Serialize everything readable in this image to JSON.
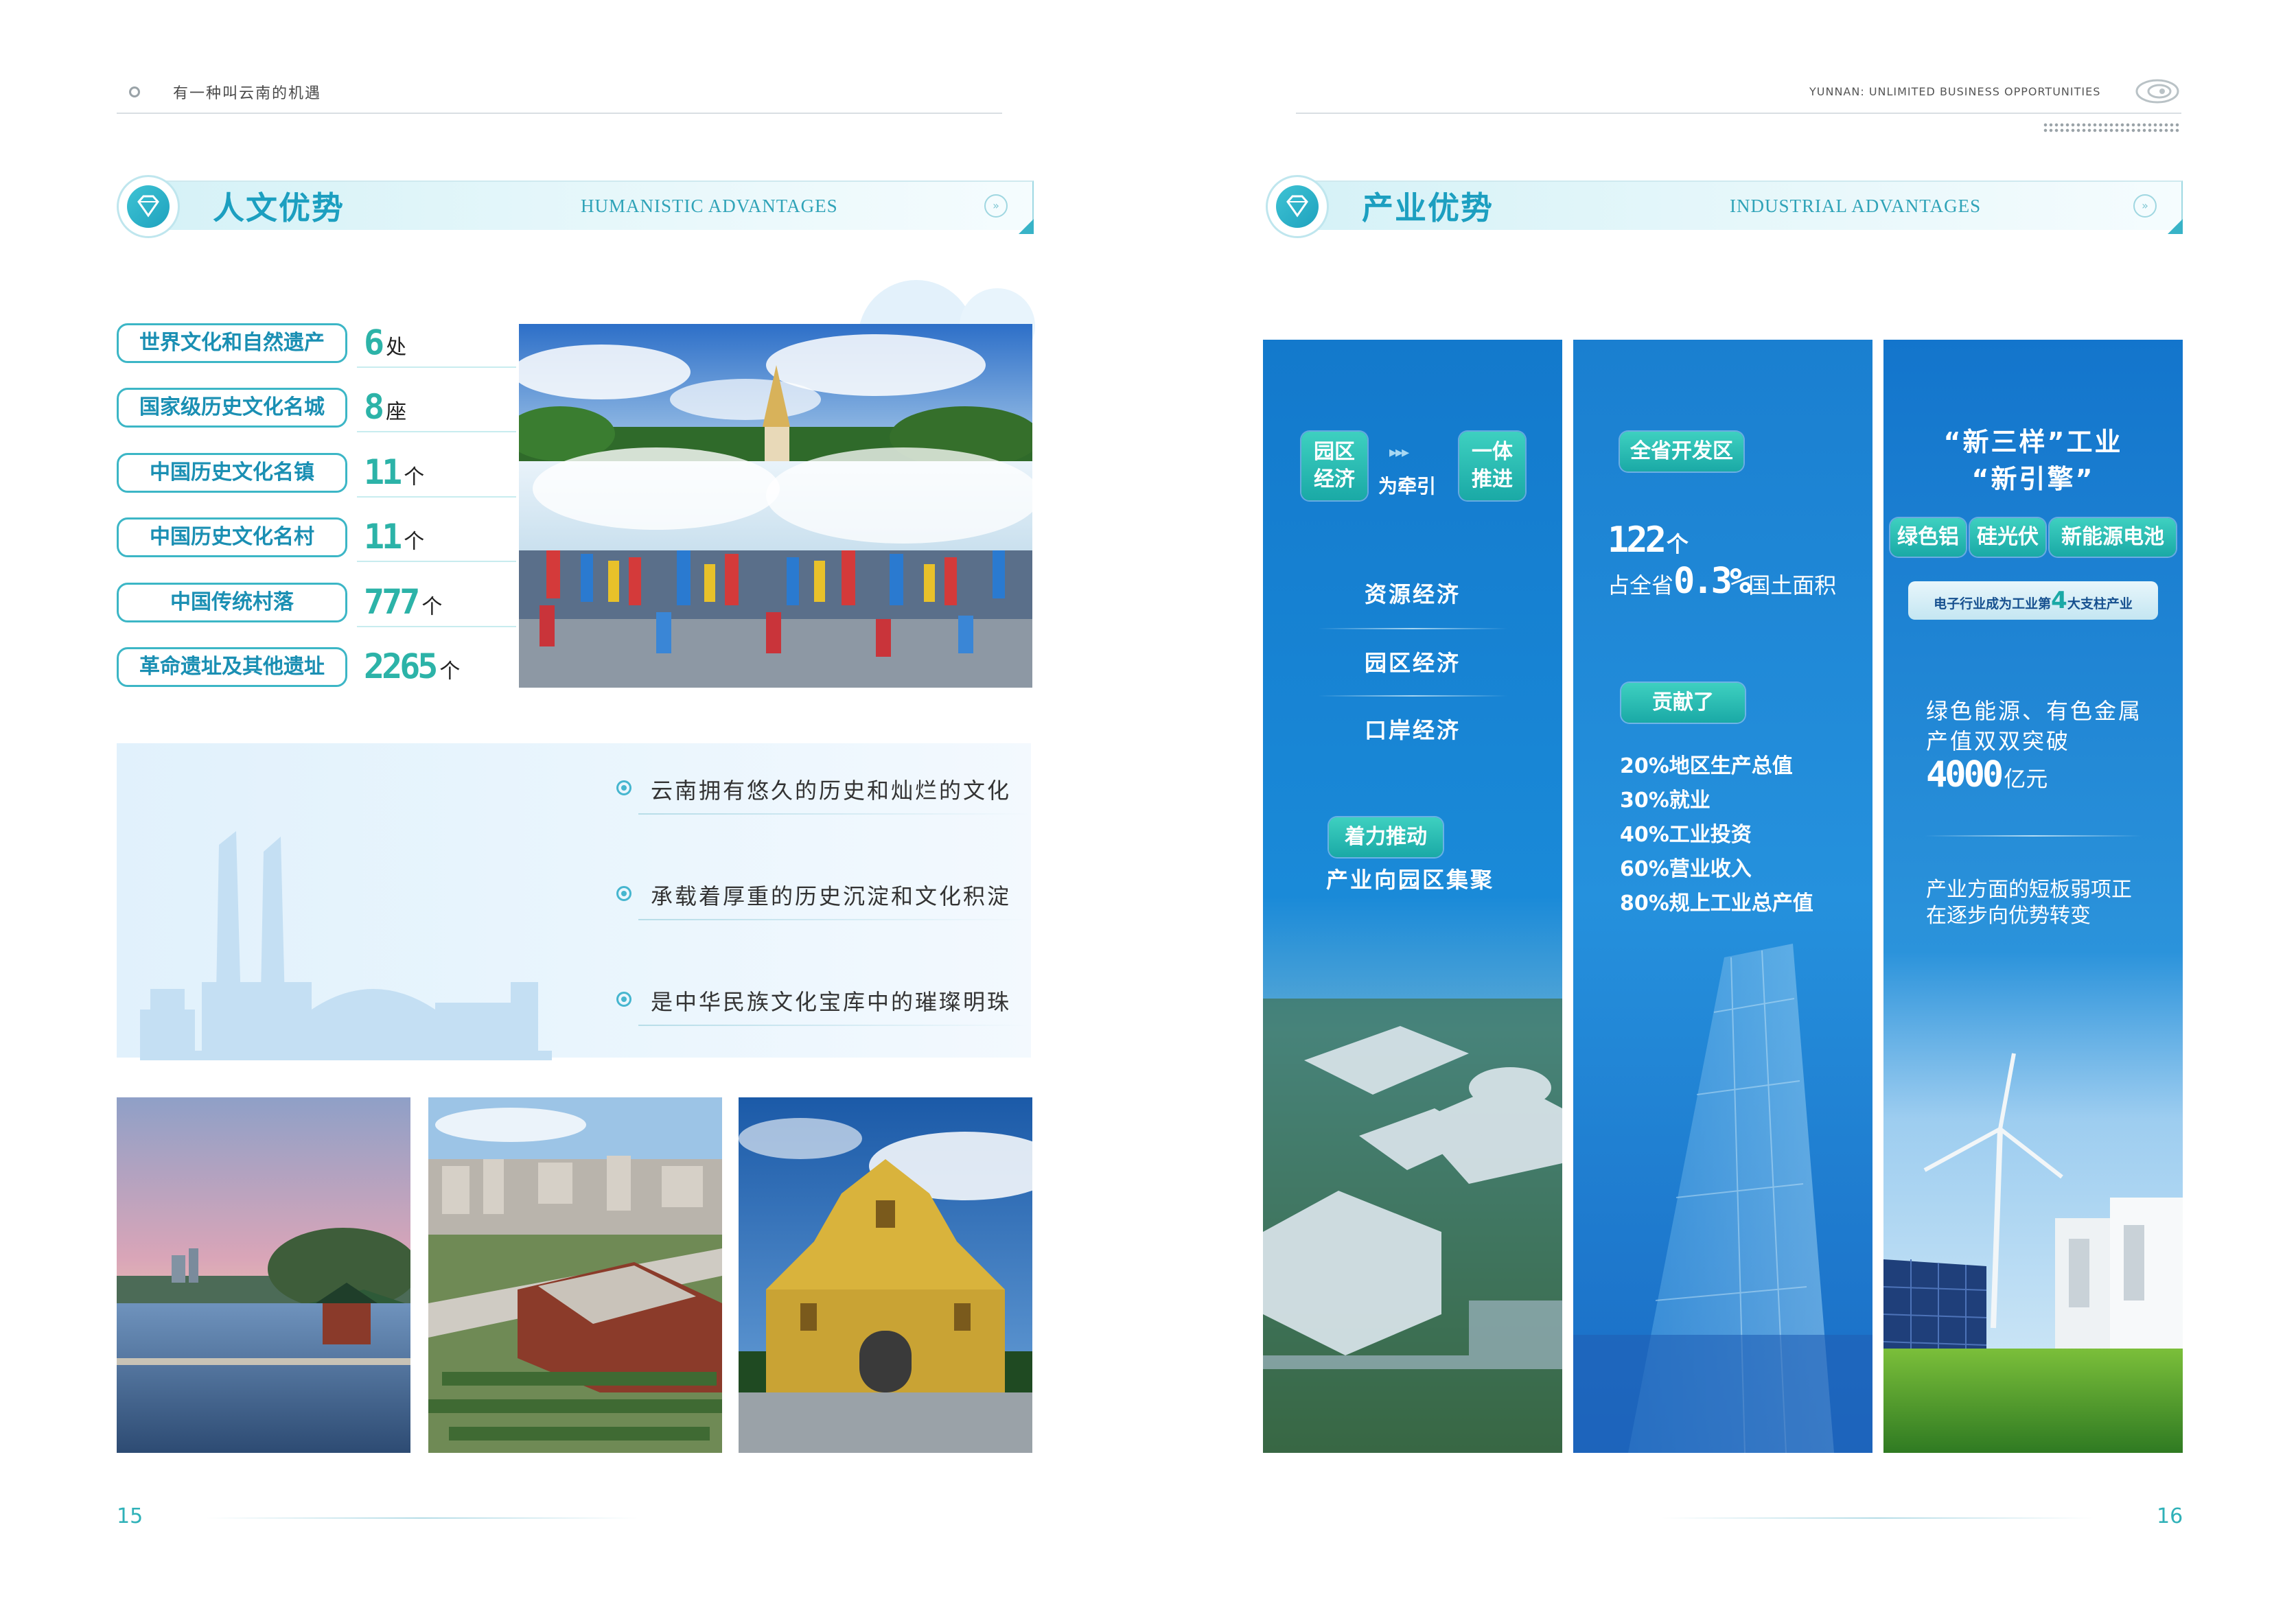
{
  "header": {
    "left_title": "有一种叫云南的机遇",
    "right_title": "YUNNAN: UNLIMITED BUSINESS OPPORTUNITIES"
  },
  "left_section": {
    "title": "人文优势",
    "title_en": "HUMANISTIC ADVANTAGES",
    "heritage": [
      {
        "label": "世界文化和自然遗产",
        "value": "6",
        "unit": "处"
      },
      {
        "label": "国家级历史文化名城",
        "value": "8",
        "unit": "座"
      },
      {
        "label": "中国历史文化名镇",
        "value": "11",
        "unit": "个"
      },
      {
        "label": "中国历史文化名村",
        "value": "11",
        "unit": "个"
      },
      {
        "label": "中国传统村落",
        "value": "777",
        "unit": "个"
      },
      {
        "label": "革命遗址及其他遗址",
        "value": "2265",
        "unit": "个"
      }
    ],
    "culture_points": [
      "云南拥有悠久的历史和灿烂的文化",
      "承载着厚重的历史沉淀和文化积淀",
      "是中华民族文化宝库中的璀璨明珠"
    ]
  },
  "right_section": {
    "title": "产业优势",
    "title_en": "INDUSTRIAL ADVANTAGES",
    "col1": {
      "tag_a": "园区经济",
      "middle": "为牵引",
      "tag_b": "一体推进",
      "items": [
        "资源经济",
        "园区经济",
        "口岸经济"
      ],
      "push_tag": "着力推动",
      "push_text": "产业向园区集聚"
    },
    "col2": {
      "tag": "全省开发区",
      "count": "122",
      "count_unit": "个",
      "area_prefix": "占全省",
      "area_value": "0.3%",
      "area_suffix": "国土面积",
      "contrib_tag": "贡献了",
      "contributions": [
        "20%地区生产总值",
        "30%就业",
        "40%工业投资",
        "60%营业收入",
        "80%规上工业总产值"
      ]
    },
    "col3": {
      "heading_line1": "“新三样”工业",
      "heading_line2": "“新引擎”",
      "tags": [
        "绿色铝",
        "硅光伏",
        "新能源电池"
      ],
      "pillar_prefix": "电子行业成为工业第",
      "pillar_num": "4",
      "pillar_suffix": "大支柱产业",
      "energy_line1": "绿色能源、有色金属",
      "energy_line2": "产值双双突破",
      "energy_value": "4000",
      "energy_unit": "亿元",
      "shift_line1": "产业方面的短板弱项正",
      "shift_line2": "在逐步向优势转变"
    }
  },
  "footer": {
    "left_page": "15",
    "right_page": "16"
  },
  "colors": {
    "accent_teal": "#2fb1b8",
    "accent_blue": "#1a8fc9",
    "column_blue": "#1273c8"
  }
}
